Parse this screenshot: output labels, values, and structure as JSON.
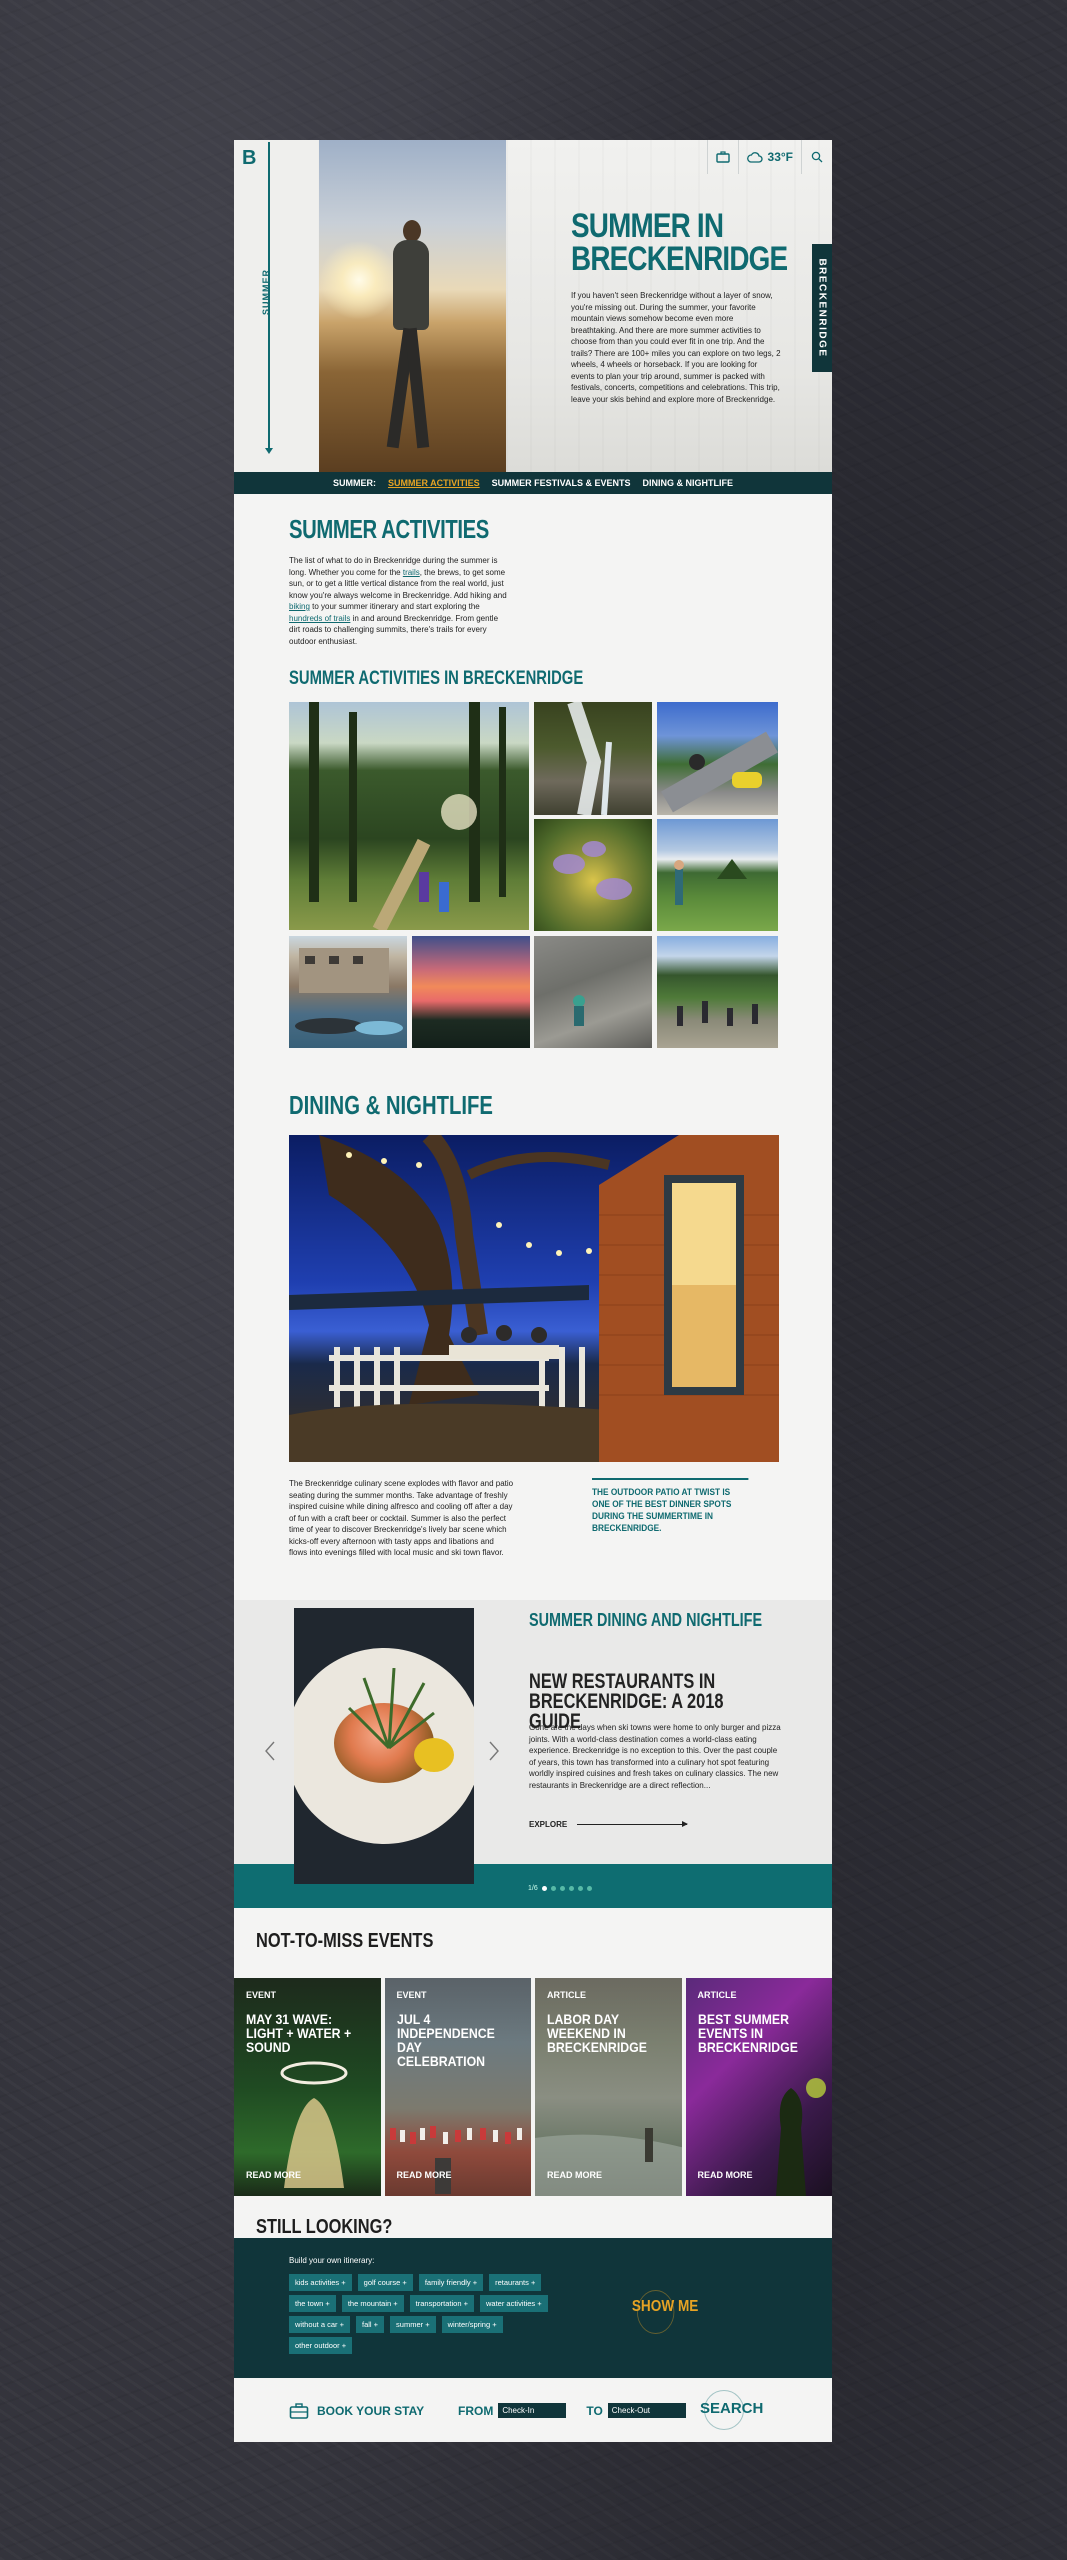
{
  "header": {
    "logo": "B",
    "sidebar_label": "SUMMER",
    "temperature": "33°F",
    "brand_tab": "BRECKENRIDGE",
    "title": "SUMMER IN BRECKENRIDGE",
    "body": "If you haven't seen Breckenridge without a layer of snow, you're missing out. During the summer, your favorite mountain views somehow become even more breathtaking. And there are more summer activities to choose from than you could ever fit in one trip. And the trails? There are 100+ miles you can explore on two legs, 2 wheels, 4 wheels or horseback. If you are looking for events to plan your trip around, summer is packed with festivals, concerts, competitions and celebrations. This trip, leave your skis behind and explore more of Breckenridge."
  },
  "subnav": {
    "label": "SUMMER:",
    "items": [
      "SUMMER ACTIVITIES",
      "SUMMER FESTIVALS & EVENTS",
      "DINING & NIGHTLIFE"
    ]
  },
  "activities": {
    "title": "SUMMER ACTIVITIES",
    "body_1": "The list of what to do in Breckenridge during the summer is long. Whether you come for the ",
    "link_1": "trails",
    "body_2": ", the brews, to get some sun, or to get a little vertical distance from the real world, just know you're always welcome in Breckenridge. Add hiking and ",
    "link_2": "biking",
    "body_3": " to your summer itinerary and start exploring the ",
    "link_3": "hundreds of trails",
    "body_4": " in and around Breckenridge. From gentle dirt roads to challenging summits, there's trails for every outdoor enthusiast.",
    "gallery_title": "SUMMER ACTIVITIES IN BRECKENRIDGE"
  },
  "dining": {
    "title": "DINING & NIGHTLIFE",
    "body": "The Breckenridge culinary scene explodes with flavor and patio seating during the summer months. Take advantage of freshly inspired cuisine while dining alfresco and cooling off after a day of fun with a craft beer or cocktail. Summer is also the perfect time of year to discover Breckenridge's lively bar scene which kicks-off every afternoon with tasty apps and libations and flows into evenings filled with local music and ski town flavor.",
    "pull_quote": "THE OUTDOOR PATIO AT TWIST IS ONE OF THE BEST DINNER SPOTS DURING THE SUMMERTIME IN BRECKENRIDGE."
  },
  "carousel": {
    "kicker": "SUMMER DINING AND NIGHTLIFE",
    "title": "NEW RESTAURANTS IN BRECKENRIDGE: A 2018 GUIDE",
    "body": "Gone are the days when ski towns were home to only burger and pizza joints. With a world-class destination comes a world-class eating experience. Breckenridge is no exception to this. Over the past couple of years, this town has transformed into a culinary hot spot featuring worldly inspired cuisines and fresh takes on culinary classics. The new restaurants in Breckenridge are a direct reflection...",
    "explore": "EXPLORE",
    "pager": "1/6"
  },
  "events": {
    "title": "NOT-TO-MISS EVENTS",
    "cards": [
      {
        "kind": "EVENT",
        "title": "MAY 31 WAVE: LIGHT + WATER + SOUND",
        "cta": "READ MORE"
      },
      {
        "kind": "EVENT",
        "title": "JUL 4 INDEPENDENCE DAY CELEBRATION",
        "cta": "READ MORE"
      },
      {
        "kind": "ARTICLE",
        "title": "LABOR DAY WEEKEND IN BRECKENRIDGE",
        "cta": "READ MORE"
      },
      {
        "kind": "ARTICLE",
        "title": "BEST SUMMER EVENTS IN BRECKENRIDGE",
        "cta": "READ MORE"
      }
    ]
  },
  "still_looking": {
    "title": "STILL LOOKING?",
    "build": "Build your own itinerary:",
    "tags": [
      "kids activities +",
      "golf course +",
      "family friendly +",
      "retaurants +",
      "the town +",
      "the mountain +",
      "transportation +",
      "water activities +",
      "without a car +",
      "fall +",
      "summer +",
      "winter/spring +",
      "other outdoor +"
    ],
    "show_me": "SHOW ME"
  },
  "booking": {
    "label": "BOOK YOUR STAY",
    "from": "FROM",
    "to": "TO",
    "checkin_placeholder": "Check-In",
    "checkout_placeholder": "Check-Out",
    "search": "SEARCH"
  },
  "colors": {
    "teal": "#0f6a70",
    "dark": "#10353a",
    "gold": "#e6a324"
  }
}
